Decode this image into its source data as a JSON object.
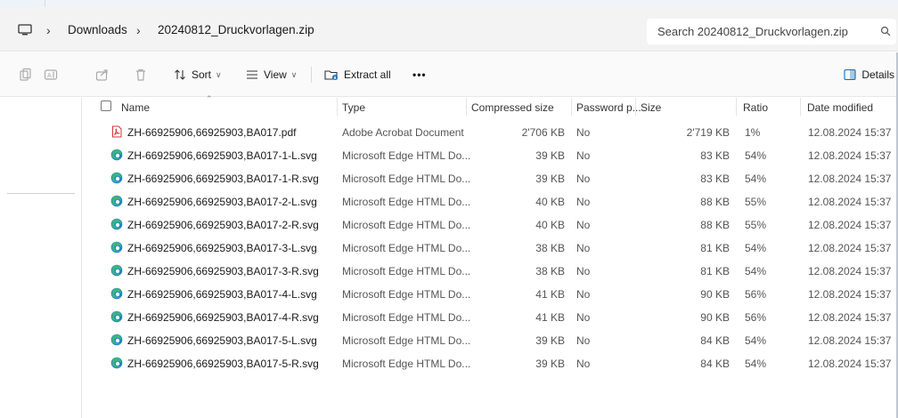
{
  "breadcrumb": {
    "items": [
      "Downloads",
      "20240812_Druckvorlagen.zip"
    ]
  },
  "search": {
    "placeholder": "Search 20240812_Druckvorlagen.zip"
  },
  "toolbar": {
    "sort_label": "Sort",
    "view_label": "View",
    "extract_label": "Extract all",
    "more_label": "•••",
    "details_label": "Details"
  },
  "columns": {
    "name": "Name",
    "type": "Type",
    "compressed": "Compressed size",
    "password": "Password p...",
    "size": "Size",
    "ratio": "Ratio",
    "modified": "Date modified"
  },
  "files": [
    {
      "name": "ZH-66925906,66925903,BA017.pdf",
      "icon": "pdf-icon",
      "type": "Adobe Acrobat Document",
      "compressed": "2'706 KB",
      "password": "No",
      "size": "2'719 KB",
      "ratio": "1%",
      "modified": "12.08.2024 15:37"
    },
    {
      "name": "ZH-66925906,66925903,BA017-1-L.svg",
      "icon": "edge-icon",
      "type": "Microsoft Edge HTML Do...",
      "compressed": "39 KB",
      "password": "No",
      "size": "83 KB",
      "ratio": "54%",
      "modified": "12.08.2024 15:37"
    },
    {
      "name": "ZH-66925906,66925903,BA017-1-R.svg",
      "icon": "edge-icon",
      "type": "Microsoft Edge HTML Do...",
      "compressed": "39 KB",
      "password": "No",
      "size": "83 KB",
      "ratio": "54%",
      "modified": "12.08.2024 15:37"
    },
    {
      "name": "ZH-66925906,66925903,BA017-2-L.svg",
      "icon": "edge-icon",
      "type": "Microsoft Edge HTML Do...",
      "compressed": "40 KB",
      "password": "No",
      "size": "88 KB",
      "ratio": "55%",
      "modified": "12.08.2024 15:37"
    },
    {
      "name": "ZH-66925906,66925903,BA017-2-R.svg",
      "icon": "edge-icon",
      "type": "Microsoft Edge HTML Do...",
      "compressed": "40 KB",
      "password": "No",
      "size": "88 KB",
      "ratio": "55%",
      "modified": "12.08.2024 15:37"
    },
    {
      "name": "ZH-66925906,66925903,BA017-3-L.svg",
      "icon": "edge-icon",
      "type": "Microsoft Edge HTML Do...",
      "compressed": "38 KB",
      "password": "No",
      "size": "81 KB",
      "ratio": "54%",
      "modified": "12.08.2024 15:37"
    },
    {
      "name": "ZH-66925906,66925903,BA017-3-R.svg",
      "icon": "edge-icon",
      "type": "Microsoft Edge HTML Do...",
      "compressed": "38 KB",
      "password": "No",
      "size": "81 KB",
      "ratio": "54%",
      "modified": "12.08.2024 15:37"
    },
    {
      "name": "ZH-66925906,66925903,BA017-4-L.svg",
      "icon": "edge-icon",
      "type": "Microsoft Edge HTML Do...",
      "compressed": "41 KB",
      "password": "No",
      "size": "90 KB",
      "ratio": "56%",
      "modified": "12.08.2024 15:37"
    },
    {
      "name": "ZH-66925906,66925903,BA017-4-R.svg",
      "icon": "edge-icon",
      "type": "Microsoft Edge HTML Do...",
      "compressed": "41 KB",
      "password": "No",
      "size": "90 KB",
      "ratio": "56%",
      "modified": "12.08.2024 15:37"
    },
    {
      "name": "ZH-66925906,66925903,BA017-5-L.svg",
      "icon": "edge-icon",
      "type": "Microsoft Edge HTML Do...",
      "compressed": "39 KB",
      "password": "No",
      "size": "84 KB",
      "ratio": "54%",
      "modified": "12.08.2024 15:37"
    },
    {
      "name": "ZH-66925906,66925903,BA017-5-R.svg",
      "icon": "edge-icon",
      "type": "Microsoft Edge HTML Do...",
      "compressed": "39 KB",
      "password": "No",
      "size": "84 KB",
      "ratio": "54%",
      "modified": "12.08.2024 15:37"
    }
  ],
  "colors": {
    "accent": "#0f6cbd",
    "pdf_red": "#d13438",
    "edge_blue": "#1b7fd0",
    "edge_green": "#3fb37f"
  }
}
